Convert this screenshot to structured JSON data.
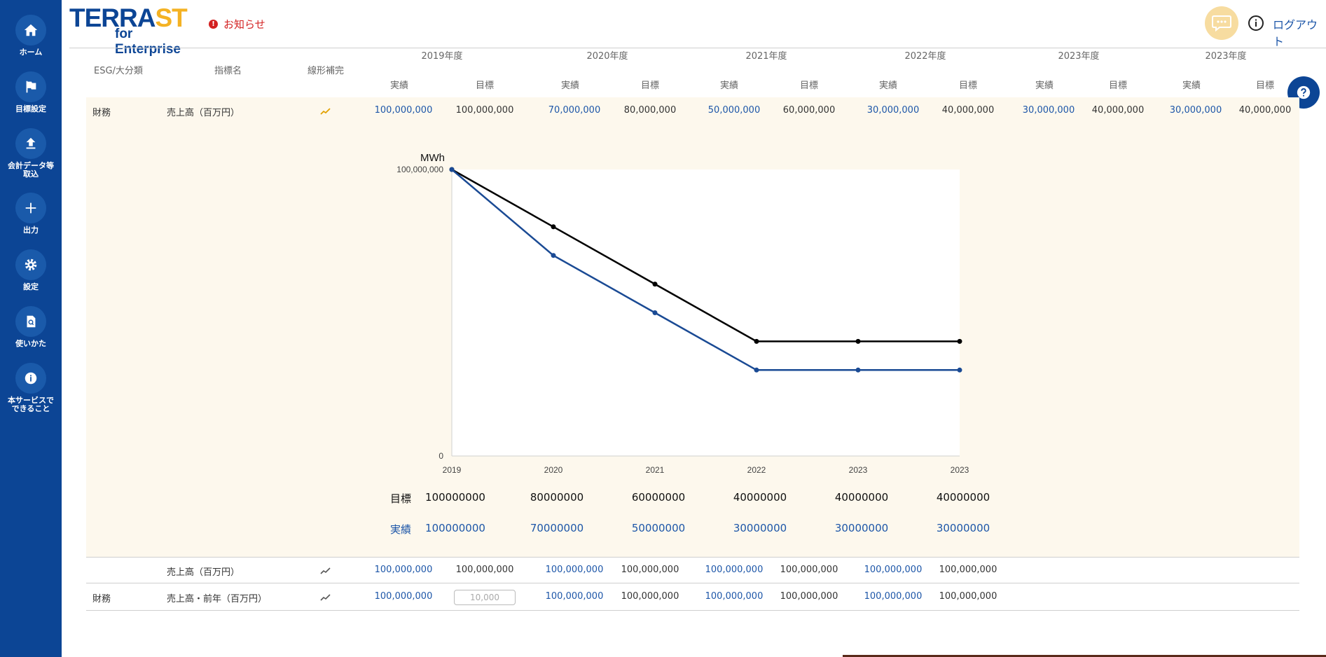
{
  "sidebar": {
    "items": [
      {
        "label": "ホーム",
        "icon": "home-icon"
      },
      {
        "label": "目標設定",
        "icon": "flag-icon"
      },
      {
        "label": "会計データ等\n取込",
        "icon": "upload-icon"
      },
      {
        "label": "出力",
        "icon": "plus-icon"
      },
      {
        "label": "設定",
        "icon": "gear-icon"
      },
      {
        "label": "使いかた",
        "icon": "document-search-icon"
      },
      {
        "label": "本サービスで\nできること",
        "icon": "info-icon"
      }
    ]
  },
  "header": {
    "logo_main_a": "TERRA",
    "logo_main_b": "ST",
    "logo_sub": "for Enterprise",
    "notice": "お知らせ",
    "logout": "ログアウト"
  },
  "table": {
    "col_headers": [
      "ESG/大分類",
      "指標名",
      "線形補完"
    ],
    "years": [
      "2019年度",
      "2020年度",
      "2021年度",
      "2022年度",
      "2023年度",
      "2023年度"
    ],
    "sub_actual": "実績",
    "sub_target": "目標",
    "rows": [
      {
        "category": "財務",
        "name": "売上高（百万円）",
        "values": [
          "100,000,000",
          "100,000,000",
          "70,000,000",
          "80,000,000",
          "50,000,000",
          "60,000,000",
          "30,000,000",
          "40,000,000",
          "30,000,000",
          "40,000,000",
          "30,000,000",
          "40,000,000"
        ]
      },
      {
        "category": "",
        "name": "売上高（百万円）",
        "values": [
          "100,000,000",
          "100,000,000",
          "100,000,000",
          "100,000,000",
          "100,000,000",
          "100,000,000",
          "100,000,000",
          "100,000,000"
        ]
      },
      {
        "category": "財務",
        "name": "売上高・前年（百万円）",
        "values": [
          "100,000,000",
          "",
          "100,000,000",
          "100,000,000",
          "100,000,000",
          "100,000,000",
          "100,000,000",
          "100,000,000"
        ],
        "input_placeholder": "10,000"
      }
    ]
  },
  "chart_data": {
    "type": "line",
    "ylabel": "MWh",
    "ylim": [
      0,
      100000000
    ],
    "yticks": [
      "100,000,000",
      "0"
    ],
    "categories": [
      "2019",
      "2020",
      "2021",
      "2022",
      "2023",
      "2023"
    ],
    "series": [
      {
        "name": "目標",
        "color": "#000000",
        "values": [
          100000000,
          80000000,
          60000000,
          40000000,
          40000000,
          40000000
        ]
      },
      {
        "name": "実績",
        "color": "#1a4a94",
        "values": [
          100000000,
          70000000,
          50000000,
          30000000,
          30000000,
          30000000
        ]
      }
    ],
    "legend_rows": [
      {
        "label": "目標",
        "values": [
          "100000000",
          "80000000",
          "60000000",
          "40000000",
          "40000000",
          "40000000"
        ]
      },
      {
        "label": "実績",
        "values": [
          "100000000",
          "70000000",
          "50000000",
          "30000000",
          "30000000",
          "30000000"
        ]
      }
    ]
  },
  "colors": {
    "sidebar": "#0c4595",
    "accent": "#f4b223",
    "blue_text": "#1d56a8",
    "notice": "#d32020",
    "panel": "#fdf8ed"
  }
}
